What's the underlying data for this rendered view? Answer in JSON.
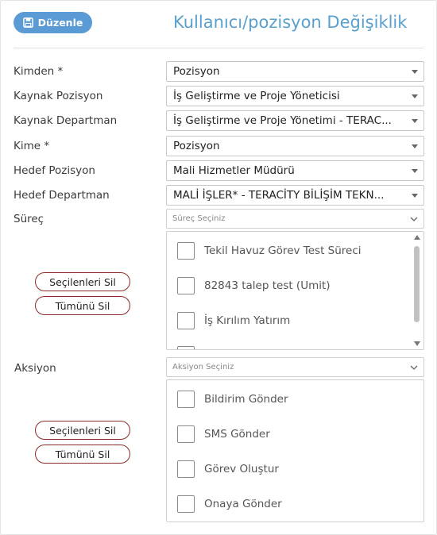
{
  "toolbar": {
    "edit_label": "Düzenle"
  },
  "page": {
    "title": "Kullanıcı/pozisyon Değişiklik"
  },
  "form": {
    "from": {
      "label": "Kimden *",
      "value": "Pozisyon"
    },
    "source_position": {
      "label": "Kaynak Pozisyon",
      "value": "İş Geliştirme ve Proje Yöneticisi"
    },
    "source_department": {
      "label": "Kaynak Departman",
      "value": "İş Geliştirme ve Proje Yönetimi - TERAC..."
    },
    "to": {
      "label": "Kime *",
      "value": "Pozisyon"
    },
    "target_position": {
      "label": "Hedef Pozisyon",
      "value": "Mali Hizmetler Müdürü"
    },
    "target_department": {
      "label": "Hedef Departman",
      "value": "MALİ İŞLER* - TERACİTY BİLİŞİM TEKN..."
    }
  },
  "process": {
    "label": "Süreç",
    "placeholder": "Süreç Seçiniz",
    "items": [
      "Tekil Havuz Görev Test Süreci",
      "82843 talep test (Umit)",
      "İş Kırılım Yatırım"
    ],
    "delete_selected_label": "Seçilenleri Sil",
    "delete_all_label": "Tümünü Sil"
  },
  "action": {
    "label": "Aksiyon",
    "placeholder": "Aksiyon Seçiniz",
    "items": [
      "Bildirim Gönder",
      "SMS Gönder",
      "Görev Oluştur",
      "Onaya Gönder"
    ],
    "delete_selected_label": "Seçilenleri Sil",
    "delete_all_label": "Tümünü Sil"
  },
  "colors": {
    "accent": "#5a9bd5",
    "title": "#5aa0cd",
    "pill_border": "#8b2a2a"
  }
}
